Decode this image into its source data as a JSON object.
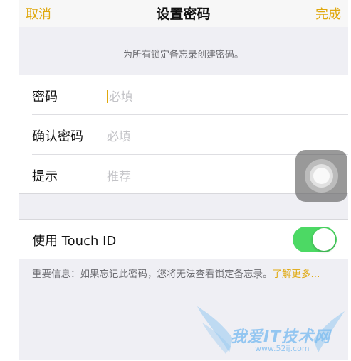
{
  "navbar": {
    "cancel_label": "取消",
    "title": "设置密码",
    "done_label": "完成"
  },
  "caption": "为所有锁定备忘录创建密码。",
  "form": {
    "password": {
      "label": "密码",
      "placeholder": "必填"
    },
    "confirm": {
      "label": "确认密码",
      "placeholder": "必填"
    },
    "hint": {
      "label": "提示",
      "placeholder": "推荐"
    }
  },
  "touch_id": {
    "label": "使用 Touch ID",
    "enabled": true
  },
  "footer": {
    "text": "重要信息：如果忘记此密码，您将无法查看锁定备忘录。",
    "link": "了解更多..."
  },
  "watermark": {
    "text": "我爱IT技术网",
    "url": "www.52ij.com"
  },
  "colors": {
    "accent": "#e0a80d",
    "toggle_on": "#4cd964",
    "background": "#efeff4"
  },
  "icons": {
    "assistive_touch": "assistive-touch-icon"
  }
}
